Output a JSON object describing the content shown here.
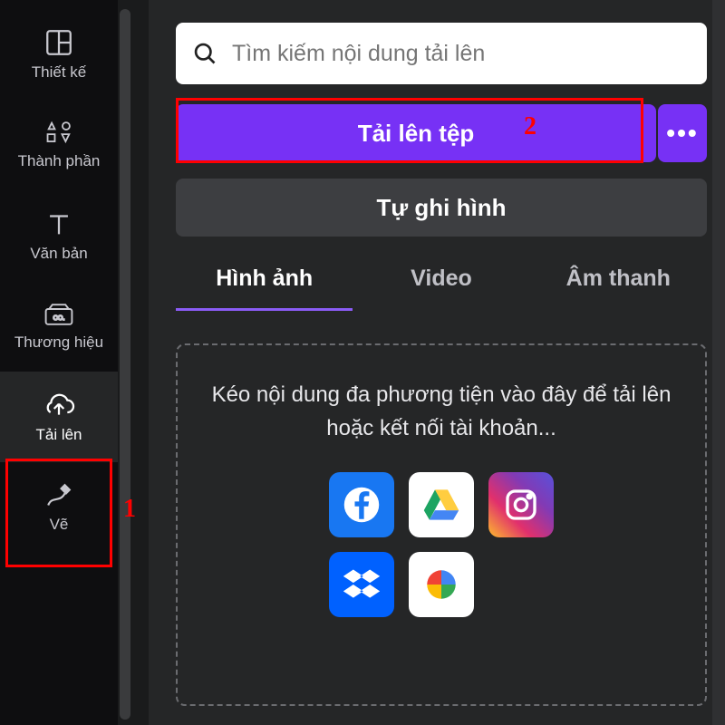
{
  "sidebar": {
    "items": [
      {
        "label": "Thiết kế",
        "name": "sidebar-item-design",
        "icon": "layout-icon"
      },
      {
        "label": "Thành phần",
        "name": "sidebar-item-elements",
        "icon": "shapes-icon"
      },
      {
        "label": "Văn bản",
        "name": "sidebar-item-text",
        "icon": "text-icon"
      },
      {
        "label": "Thương hiệu",
        "name": "sidebar-item-brand",
        "icon": "brand-icon"
      },
      {
        "label": "Tải lên",
        "name": "sidebar-item-upload",
        "icon": "cloud-upload-icon",
        "active": true
      },
      {
        "label": "Vẽ",
        "name": "sidebar-item-draw",
        "icon": "draw-icon"
      }
    ]
  },
  "search": {
    "placeholder": "Tìm kiếm nội dung tải lên"
  },
  "upload": {
    "button_label": "Tải lên tệp",
    "more_label": "•••"
  },
  "record": {
    "button_label": "Tự ghi hình"
  },
  "tabs": [
    {
      "label": "Hình ảnh",
      "name": "tab-images",
      "active": true
    },
    {
      "label": "Video",
      "name": "tab-video"
    },
    {
      "label": "Âm thanh",
      "name": "tab-audio"
    }
  ],
  "dropzone": {
    "text": "Kéo nội dung đa phương tiện vào đây để tải lên hoặc kết nối tài khoản..."
  },
  "services": [
    {
      "name": "service-facebook",
      "icon": "facebook-icon"
    },
    {
      "name": "service-google-drive",
      "icon": "google-drive-icon"
    },
    {
      "name": "service-instagram",
      "icon": "instagram-icon"
    },
    {
      "name": "service-dropbox",
      "icon": "dropbox-icon"
    },
    {
      "name": "service-google-photos",
      "icon": "google-photos-icon"
    }
  ],
  "annotations": {
    "one": "1",
    "two": "2"
  },
  "colors": {
    "accent": "#7731f5",
    "highlight": "#ff0000"
  }
}
